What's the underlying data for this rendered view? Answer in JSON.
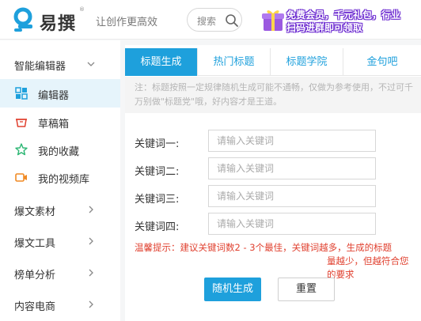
{
  "header": {
    "brand": "易撰",
    "brand_mark": "®",
    "slogan": "让创作更高效",
    "search_placeholder": "搜索",
    "promo_line1": "免费会员，千元礼包，行业",
    "promo_line2": "扫码进群即可领取",
    "colors": {
      "logo": "#1ea0dc",
      "promo_text": "#ffffff",
      "promo_outline": "#6c2bd0"
    }
  },
  "sidebar": {
    "groups": [
      {
        "label": "智能编辑器",
        "expanded": true,
        "icon": "chevron-down-icon"
      },
      {
        "label": "爆文素材",
        "icon": "chevron-right-icon"
      },
      {
        "label": "爆文工具",
        "icon": "chevron-right-icon"
      },
      {
        "label": "榜单分析",
        "icon": "chevron-right-icon"
      },
      {
        "label": "内容电商",
        "icon": "chevron-right-icon"
      }
    ],
    "items": [
      {
        "label": "编辑器",
        "icon": "grid-icon",
        "active": true
      },
      {
        "label": "草稿箱",
        "icon": "basket-icon"
      },
      {
        "label": "我的收藏",
        "icon": "star-icon"
      },
      {
        "label": "我的视频库",
        "icon": "video-icon"
      }
    ],
    "active_bg": "#e6f4fb"
  },
  "tabs": [
    {
      "label": "标题生成",
      "active": true
    },
    {
      "label": "热门标题"
    },
    {
      "label": "标题学院"
    },
    {
      "label": "金句吧"
    }
  ],
  "note": "注：标题按照一定规律随机生成可能不通畅，仅做为参考使用，不过可千万别做\"标题党\"哦，好内容才是王道。",
  "fields": [
    {
      "label": "关键词一:",
      "placeholder": "请输入关键词"
    },
    {
      "label": "关键词二:",
      "placeholder": "请输入关键词"
    },
    {
      "label": "关键词三:",
      "placeholder": "请输入关键词"
    },
    {
      "label": "关键词四:",
      "placeholder": "请输入关键词"
    }
  ],
  "tip_line1": "温馨提示：建议关键词数2 - 3个最佳，关键词越多，生成的标题",
  "tip_line2": "量越少，但越符合您的要求",
  "buttons": {
    "generate": "随机生成",
    "reset": "重置"
  },
  "accent": "#1ea0dc",
  "tip_color": "#e0402f"
}
